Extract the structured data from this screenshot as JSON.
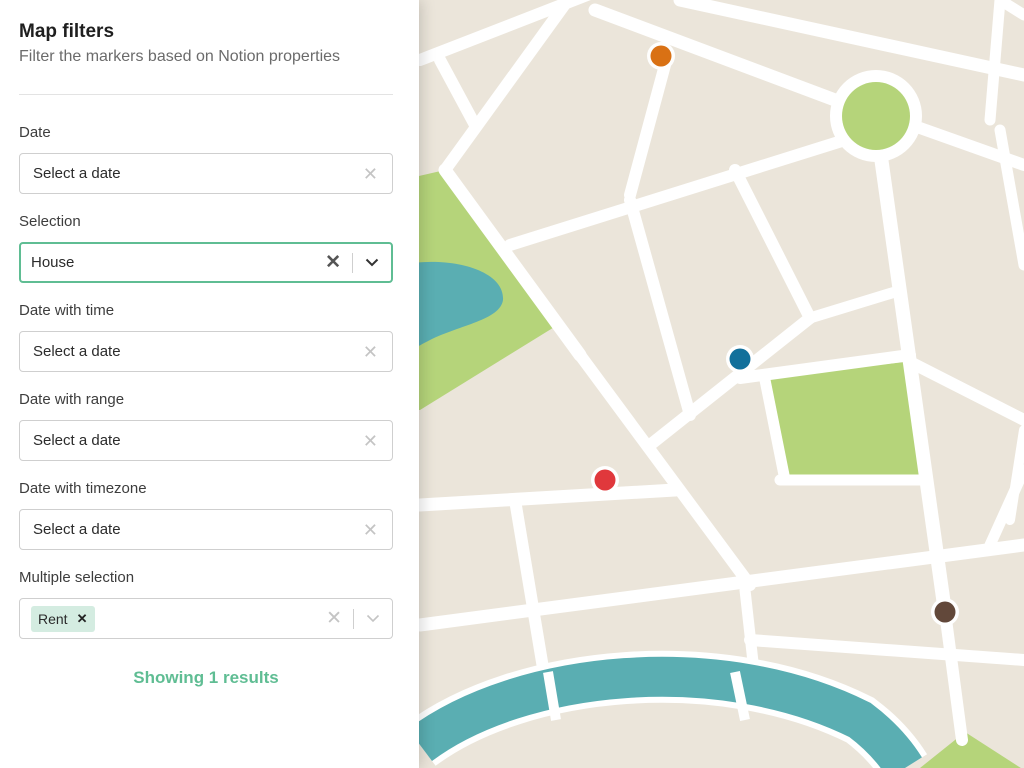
{
  "map": {
    "markers": [
      {
        "name": "orange",
        "color": "#d97114"
      },
      {
        "name": "blue",
        "color": "#12709b"
      },
      {
        "name": "red",
        "color": "#e0383c"
      },
      {
        "name": "brown",
        "color": "#62483a"
      }
    ],
    "colors": {
      "land": "#ebe5da",
      "park": "#b5d47a",
      "water": "#5aaeb2",
      "road": "#ffffff"
    }
  },
  "panel": {
    "title": "Map filters",
    "subtitle": "Filter the markers based on Notion properties",
    "filters": {
      "date": {
        "label": "Date",
        "placeholder": "Select a date"
      },
      "selection": {
        "label": "Selection",
        "value": "House"
      },
      "date_time": {
        "label": "Date with time",
        "placeholder": "Select a date"
      },
      "date_range": {
        "label": "Date with range",
        "placeholder": "Select a date"
      },
      "date_tz": {
        "label": "Date with timezone",
        "placeholder": "Select a date"
      },
      "multi": {
        "label": "Multiple selection",
        "chips": [
          "Rent"
        ]
      }
    },
    "results": "Showing 1 results"
  },
  "accent": "#5fbd93"
}
